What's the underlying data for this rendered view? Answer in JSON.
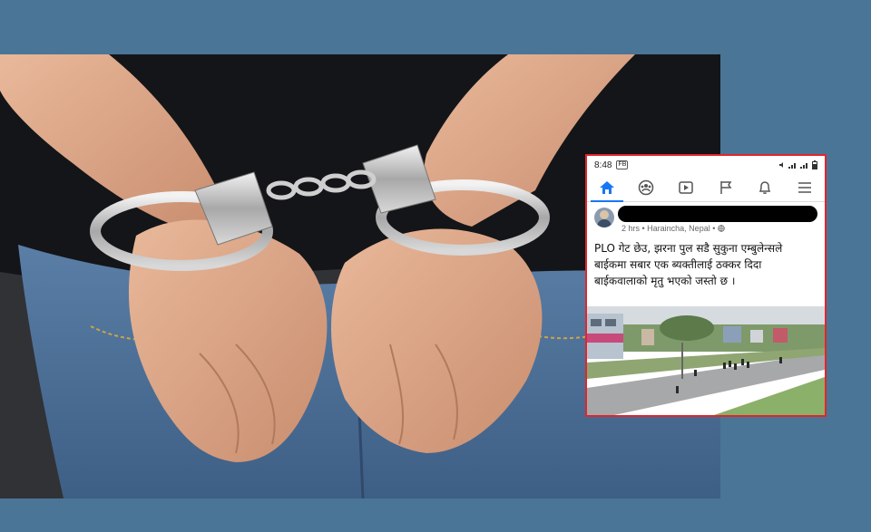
{
  "colors": {
    "page_background": "#4a7596",
    "highlight_border": "#e2252b",
    "facebook_blue": "#1877f2"
  },
  "photo": {
    "subject": "person-in-handcuffs"
  },
  "screenshot": {
    "status_bar": {
      "time": "8:48",
      "tag": "FB"
    },
    "nav_icons": [
      "home-icon",
      "groups-icon",
      "watch-icon",
      "pages-icon",
      "bell-icon",
      "menu-icon"
    ],
    "post": {
      "author": "",
      "time_location": "2 hrs • Haraincha, Nepal • ",
      "text": "PLO गेट छेउ, झरना पुल सडै सुकुना एम्बुलेन्सले बाईकमा सबार एक ब्यक्तीलाई ठक्कर दिदा बाईकवालाको मृतु भएको जस्तो छ ।"
    }
  }
}
